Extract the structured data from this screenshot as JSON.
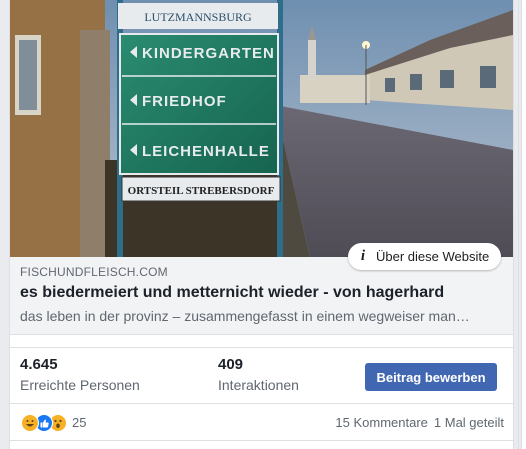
{
  "photo": {
    "sign_top": "LUTZMANNSBURG",
    "sign_items": [
      "KINDERGARTEN",
      "FRIEDHOF",
      "LEICHENHALLE"
    ],
    "sign_bottom": "ORTSTEIL STREBERSDORF",
    "colors": {
      "sign_green": "#1f7a62",
      "sky": "#5e7e9e",
      "road": "#5a5a66"
    }
  },
  "about_pill": {
    "icon": "info-icon",
    "label": "Über diese Website"
  },
  "link": {
    "domain": "FISCHUNDFLEISCH.COM",
    "title": "es biedermeiert und metternicht wieder - von hagerhard",
    "description": "das leben in der provinz – zusammengefasst in einem wegweiser man…"
  },
  "stats": {
    "reach_value": "4.645",
    "reach_label": "Erreichte Personen",
    "interactions_value": "409",
    "interactions_label": "Interaktionen",
    "boost_label": "Beitrag bewerben"
  },
  "reactions": {
    "icons": [
      "haha-icon",
      "like-icon",
      "wow-icon"
    ],
    "count": "25",
    "comments": "15 Kommentare",
    "shares": "1 Mal geteilt"
  },
  "colors": {
    "accent": "#4267b2",
    "muted_text": "#606770",
    "card_bg": "#f2f3f5"
  }
}
